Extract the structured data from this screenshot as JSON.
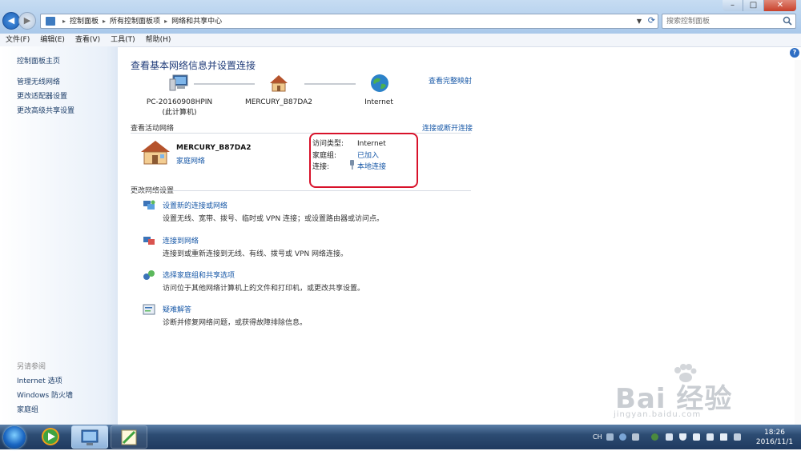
{
  "address_bar": {
    "breadcrumbs": [
      "控制面板",
      "所有控制面板项",
      "网络和共享中心"
    ]
  },
  "search": {
    "placeholder": "搜索控制面板"
  },
  "menu": [
    "文件(F)",
    "编辑(E)",
    "查看(V)",
    "工具(T)",
    "帮助(H)"
  ],
  "sidebar": {
    "home": "控制面板主页",
    "links": [
      "管理无线网络",
      "更改适配器设置",
      "更改高级共享设置"
    ],
    "see_also_label": "另请参阅",
    "see_also": [
      "Internet 选项",
      "Windows 防火墙",
      "家庭组"
    ]
  },
  "main": {
    "title": "查看基本网络信息并设置连接",
    "see_full_map": "查看完整映射",
    "map": {
      "computer": "PC-20160908HPIN",
      "computer_sub": "(此计算机)",
      "router": "MERCURY_B87DA2",
      "internet": "Internet"
    },
    "active_networks_label": "查看活动网络",
    "connect_disconnect": "连接或断开连接",
    "network": {
      "name": "MERCURY_B87DA2",
      "type": "家庭网络",
      "access_type_label": "访问类型:",
      "access_type_value": "Internet",
      "homegroup_label": "家庭组:",
      "homegroup_value": "已加入",
      "connection_label": "连接:",
      "connection_value": "本地连接"
    },
    "change_settings_label": "更改网络设置",
    "tasks": [
      {
        "title": "设置新的连接或网络",
        "desc": "设置无线、宽带、拨号、临时或 VPN 连接；或设置路由器或访问点。"
      },
      {
        "title": "连接到网络",
        "desc": "连接到或重新连接到无线、有线、拨号或 VPN 网络连接。"
      },
      {
        "title": "选择家庭组和共享选项",
        "desc": "访问位于其他网络计算机上的文件和打印机，或更改共享设置。"
      },
      {
        "title": "疑难解答",
        "desc": "诊断并修复网络问题，或获得故障排除信息。"
      }
    ]
  },
  "watermark": {
    "brand": "Bai 经验",
    "url": "jingyan.baidu.com"
  },
  "taskbar": {
    "lang": "CH",
    "time": "18:26",
    "date": "2016/11/1"
  },
  "colors": {
    "link": "#1a5aa8",
    "highlight_border": "#d8122a",
    "title": "#1e3a78"
  }
}
